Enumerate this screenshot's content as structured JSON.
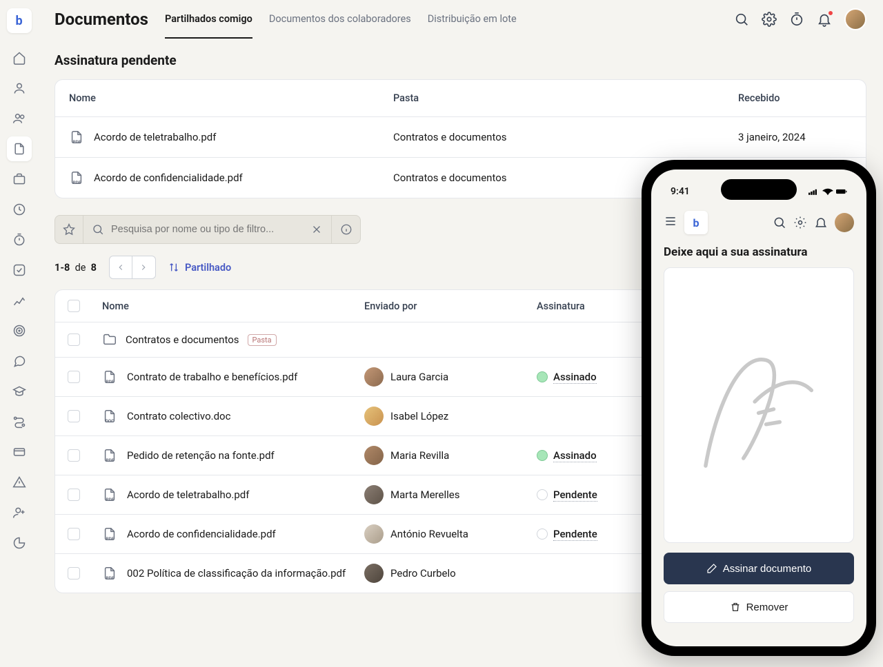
{
  "header": {
    "title": "Documentos",
    "tabs": [
      "Partilhados comigo",
      "Documentos dos colaboradores",
      "Distribuição em lote"
    ],
    "active_tab": 0
  },
  "pending": {
    "section_title": "Assinatura pendente",
    "columns": {
      "name": "Nome",
      "folder": "Pasta",
      "received": "Recebido"
    },
    "rows": [
      {
        "name": "Acordo de teletrabalho.pdf",
        "folder": "Contratos e documentos",
        "received": "3 janeiro, 2024"
      },
      {
        "name": "Acordo de confidencialidade.pdf",
        "folder": "Contratos e documentos",
        "received": ""
      }
    ]
  },
  "search": {
    "placeholder": "Pesquisa por nome ou tipo de filtro..."
  },
  "pager": {
    "range": "1-8",
    "of_label": "de",
    "total": "8",
    "sort_label": "Partilhado"
  },
  "docs": {
    "columns": {
      "name": "Nome",
      "sender": "Enviado por",
      "signature": "Assinatura"
    },
    "folder": {
      "name": "Contratos e documentos",
      "badge": "Pasta"
    },
    "rows": [
      {
        "name": "Contrato de trabalho e benefícios.pdf",
        "ext": "PDF",
        "sender": "Laura Garcia",
        "status": "Assinado",
        "status_kind": "green"
      },
      {
        "name": "Contrato colectivo.doc",
        "ext": "DOC",
        "sender": "Isabel López",
        "status": "",
        "status_kind": ""
      },
      {
        "name": "Pedido de retenção na fonte.pdf",
        "ext": "PDF",
        "sender": "Maria Revilla",
        "status": "Assinado",
        "status_kind": "green"
      },
      {
        "name": "Acordo de teletrabalho.pdf",
        "ext": "PDF",
        "sender": "Marta Merelles",
        "status": "Pendente",
        "status_kind": "grey"
      },
      {
        "name": "Acordo de confidencialidade.pdf",
        "ext": "PDF",
        "sender": "António Revuelta",
        "status": "Pendente",
        "status_kind": "grey"
      },
      {
        "name": "002 Política de classificação da informação.pdf",
        "ext": "PDF",
        "sender": "Pedro Curbelo",
        "status": "",
        "status_kind": ""
      }
    ]
  },
  "phone": {
    "time": "9:41",
    "title": "Deixe aqui a sua assinatura",
    "sign_button": "Assinar documento",
    "remove_button": "Remover"
  }
}
